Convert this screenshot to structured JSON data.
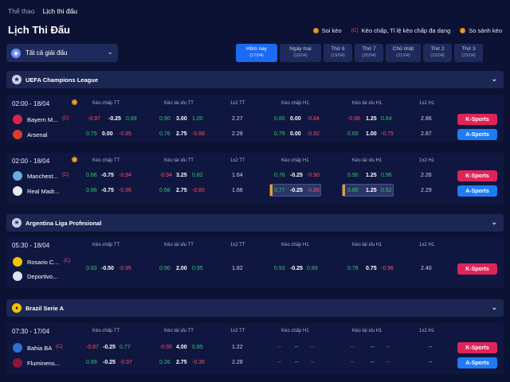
{
  "nav": {
    "sports": "Thể thao",
    "schedule": "Lịch thi đấu"
  },
  "page_title": "Lịch Thi Đấu",
  "legend": {
    "tips": "Soi kèo",
    "odds": "Kèo chấp, Tỉ lệ kèo chấp đa dạng",
    "compare": "So sánh kèo",
    "odds_marker": "(C)"
  },
  "league_select": {
    "label": "Tất cả giải đấu"
  },
  "days": [
    {
      "label": "Hôm nay",
      "date": "(17/04)"
    },
    {
      "label": "Ngày mai",
      "date": "(18/04)"
    },
    {
      "label": "Thứ 6",
      "date": "(19/04)"
    },
    {
      "label": "Thứ 7",
      "date": "(20/04)"
    },
    {
      "label": "Chủ nhật",
      "date": "(21/04)"
    },
    {
      "label": "Thứ 2",
      "date": "(22/04)"
    },
    {
      "label": "Thứ 3",
      "date": "(23/04)"
    }
  ],
  "col_headers": {
    "hcp_ft": "Kèo chấp TT",
    "ou_ft": "Kèo tài xỉu TT",
    "x12_ft": "1x2 TT",
    "hcp_h1": "Kèo chấp H1",
    "ou_h1": "Kèo tài xỉu H1",
    "x12_h1": "1x2 H1"
  },
  "buttons": {
    "k": "K-Sports",
    "a": "A-Sports"
  },
  "leagues": [
    {
      "name": "UEFA Champions League"
    },
    {
      "name": "Argentina Liga Profesional"
    },
    {
      "name": "Brazil Serie A"
    }
  ],
  "matches": [
    {
      "time": "02:00 - 18/04",
      "home": {
        "name": "Bayern M...",
        "tag": "(C)",
        "hcp": [
          "-0.97",
          "-0.25",
          "0.89"
        ],
        "ou": [
          "0.90",
          "3.00",
          "1.00"
        ],
        "x12": "2.27",
        "hcp1": [
          "0.80",
          "0.00",
          "-0.84"
        ],
        "ou1": [
          "-0.98",
          "1.25",
          "0.84"
        ],
        "x121": "2.86"
      },
      "away": {
        "name": "Arsenal",
        "tag": "",
        "hcp": [
          "0.75",
          "0.00",
          "-0.85"
        ],
        "ou": [
          "0.76",
          "2.75",
          "-0.88"
        ],
        "x12": "2.29",
        "hcp1": [
          "0.79",
          "0.00",
          "-0.92"
        ],
        "ou1": [
          "0.65",
          "1.00",
          "-0.75"
        ],
        "x121": "2.87"
      }
    },
    {
      "time": "02:00 - 18/04",
      "home": {
        "name": "Manchest...",
        "tag": "(C)",
        "hcp": [
          "0.86",
          "-0.75",
          "-0.94"
        ],
        "ou": [
          "-0.94",
          "3.25",
          "0.82"
        ],
        "x12": "1.64",
        "hcp1": [
          "0.76",
          "-0.25",
          "-0.90"
        ],
        "ou1": [
          "0.90",
          "1.25",
          "0.96"
        ],
        "x121": "2.26"
      },
      "away": {
        "name": "Real Madr...",
        "tag": "",
        "hcp": [
          "0.86",
          "-0.75",
          "-0.96"
        ],
        "ou": [
          "0.68",
          "2.75",
          "-0.80"
        ],
        "x12": "1.66",
        "hcp1": [
          "0.77",
          "-0.25",
          "-0.89"
        ],
        "ou1": [
          "0.85",
          "1.25",
          "0.92"
        ],
        "x121": "2.29"
      }
    },
    {
      "time": "05:30 - 18/04",
      "home": {
        "name": "Rosario C...",
        "tag": "(C)"
      },
      "away": {
        "name": "Deportivo..."
      },
      "line": {
        "hcp": [
          "0.83",
          "-0.50",
          "-0.95"
        ],
        "ou": [
          "0.90",
          "2.00",
          "0.95"
        ],
        "x12": "1.82",
        "hcp1": [
          "0.93",
          "-0.25",
          "0.89"
        ],
        "ou1": [
          "0.78",
          "0.75",
          "-0.96"
        ],
        "x121": "2.40"
      }
    },
    {
      "time": "07:30 - 17/04",
      "home": {
        "name": "Bahia BA",
        "tag": "(C)",
        "hcp": [
          "-0.87",
          "-0.25",
          "0.77"
        ],
        "ou": [
          "-0.95",
          "4.00",
          "0.85"
        ],
        "x12": "1.22",
        "hcp1": [
          "--",
          "--",
          "--"
        ],
        "ou1": [
          "--",
          "--",
          "--"
        ],
        "x121": "--"
      },
      "away": {
        "name": "Fluminens...",
        "tag": "",
        "hcp": [
          "0.89",
          "-0.25",
          "-0.97"
        ],
        "ou": [
          "0.26",
          "2.75",
          "-0.36"
        ],
        "x12": "2.28",
        "hcp1": [
          "--",
          "--",
          "--"
        ],
        "ou1": [
          "--",
          "--",
          "--"
        ],
        "x121": "--"
      }
    }
  ]
}
